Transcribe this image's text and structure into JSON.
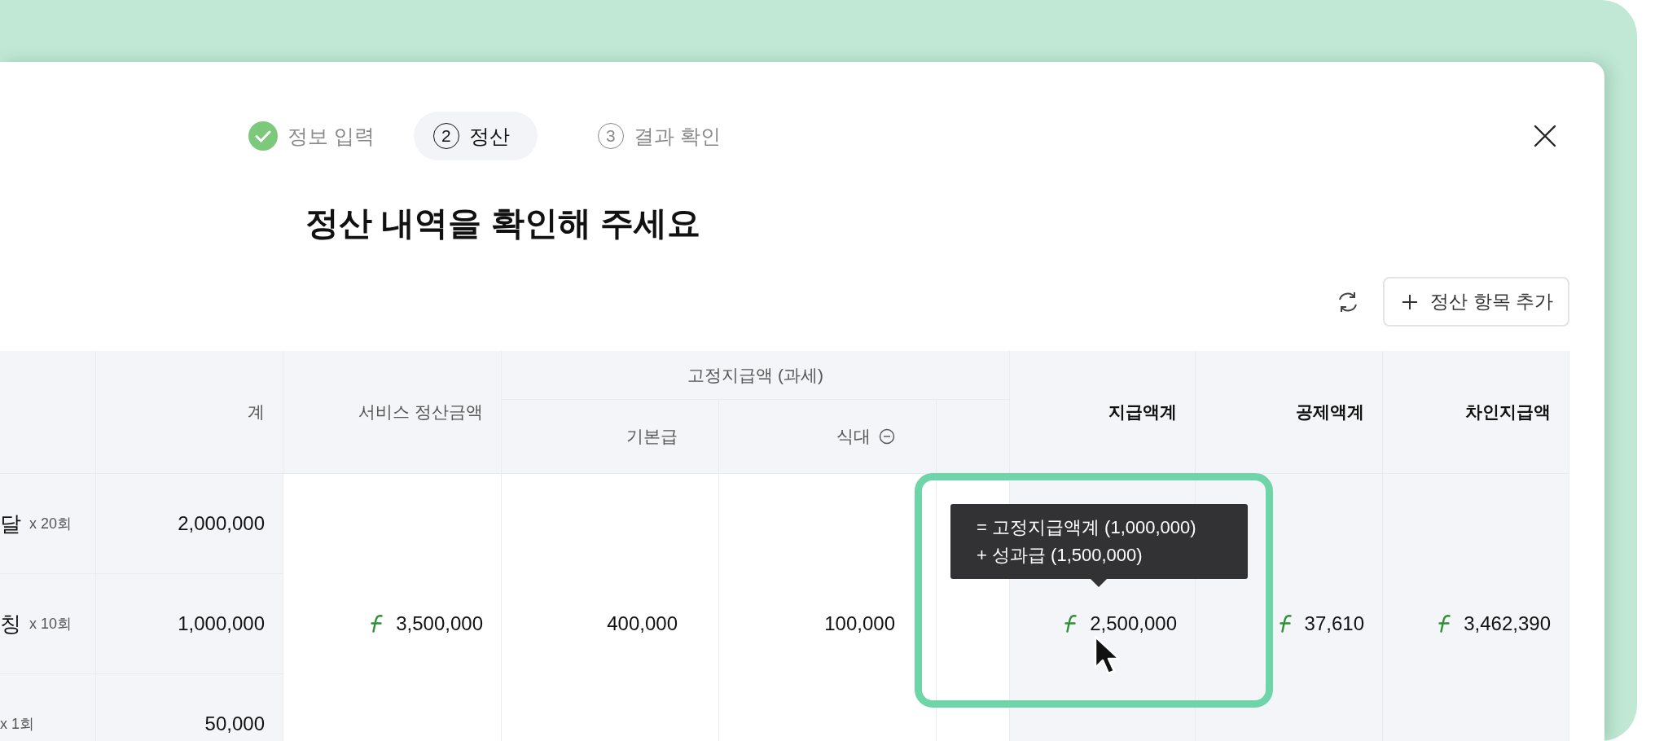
{
  "steps": [
    {
      "label": "정보 입력",
      "done": true,
      "selected": false
    },
    {
      "label": "정산",
      "done": false,
      "selected": true,
      "marker": "2"
    },
    {
      "label": "결과 확인",
      "done": false,
      "selected": false,
      "marker": "3"
    }
  ],
  "title": "정산 내역을 확인해 주세요",
  "toolbar": {
    "add_button": "정산 항목 추가"
  },
  "table": {
    "group_label": "고정지급액 (과세)",
    "columns": [
      {
        "kind": "item"
      },
      {
        "kind": "amount",
        "label": "계"
      },
      {
        "kind": "total",
        "label": "서비스 정산금액",
        "value": "3,500,000",
        "currency": true
      },
      {
        "kind": "sub",
        "label": "기본급",
        "value": "400,000",
        "currency": false,
        "collapsible": false
      },
      {
        "kind": "sub",
        "label": "식대",
        "value": "100,000",
        "currency": false,
        "collapsible": true
      },
      {
        "kind": "sub"
      },
      {
        "kind": "summary",
        "label": "지급액계",
        "value": "2,500,000",
        "currency": true,
        "highlighted": true,
        "tooltip": [
          "= 고정지급액계 (1,000,000)",
          "+ 성과급 (1,500,000)"
        ]
      },
      {
        "kind": "summary",
        "label": "공제액계",
        "value": "37,610",
        "currency": true
      },
      {
        "kind": "summary",
        "label": "차인지급액",
        "value": "3,462,390",
        "currency": true
      }
    ],
    "rows": [
      {
        "item": "달",
        "count": "x 20회",
        "amount": "2,000,000"
      },
      {
        "item": "칭",
        "count": "x 10회",
        "amount": "1,000,000"
      },
      {
        "count": "x 1회",
        "amount": "50,000"
      }
    ]
  }
}
